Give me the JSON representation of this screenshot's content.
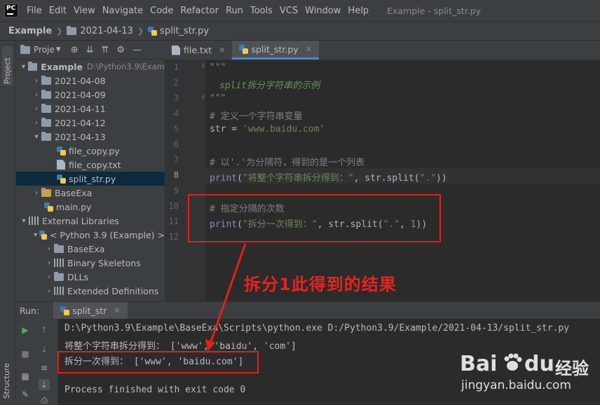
{
  "app": {
    "logo": "PC",
    "menu": [
      "File",
      "Edit",
      "View",
      "Navigate",
      "Code",
      "Refactor",
      "Run",
      "Tools",
      "VCS",
      "Window",
      "Help"
    ],
    "window_title": "Example - split_str.py"
  },
  "breadcrumb": [
    "Example",
    "2021-04-13",
    "split_str.py"
  ],
  "sidebar": {
    "tabs": {
      "project": "Project",
      "structure": "Structure"
    },
    "header_label": "Proje",
    "tree": [
      {
        "label": "Example",
        "path": "D:\\Python3.9\\Exam",
        "kind": "root"
      },
      {
        "label": "2021-04-08",
        "kind": "folder"
      },
      {
        "label": "2021-04-09",
        "kind": "folder"
      },
      {
        "label": "2021-04-11",
        "kind": "folder"
      },
      {
        "label": "2021-04-12",
        "kind": "folder"
      },
      {
        "label": "2021-04-13",
        "kind": "folder-open"
      },
      {
        "label": "file_copy.py",
        "kind": "py"
      },
      {
        "label": "file_copy.txt",
        "kind": "txt"
      },
      {
        "label": "split_str.py",
        "kind": "py"
      },
      {
        "label": "BaseExa",
        "kind": "folder-excluded"
      },
      {
        "label": "main.py",
        "kind": "py"
      },
      {
        "label": "External Libraries",
        "kind": "lib"
      },
      {
        "label": "< Python 3.9 (Example) >",
        "kind": "python"
      },
      {
        "label": "BaseExa",
        "kind": "folder"
      },
      {
        "label": "Binary Skeletons",
        "kind": "lib"
      },
      {
        "label": "DLLs",
        "kind": "folder"
      },
      {
        "label": "Extended Definitions",
        "kind": "lib"
      }
    ]
  },
  "editor": {
    "tabs": [
      "file.txt",
      "split_str.py"
    ],
    "line_numbers": [
      "1",
      "2",
      "3",
      "4",
      "5",
      "6",
      "7",
      "8",
      "9",
      "10",
      "11",
      "12"
    ],
    "code": {
      "l1": "\"\"\"",
      "l2": "split拆分字符串的示例",
      "l3": "\"\"\"",
      "l4": "# 定义一个字符串变量",
      "l5_a": "str = ",
      "l5_b": "'www.baidu.com'",
      "l7": "# 以'.'为分隔符，得到的是一个列表",
      "l8_kw": "print",
      "l8_a": "(",
      "l8_s1": "\"将整个字符串拆分得到：\"",
      "l8_b": ", str.split(",
      "l8_s2": "\".\"",
      "l8_c": "))",
      "l10": "# 指定分隔的次数",
      "l11_kw": "print",
      "l11_a": "(",
      "l11_s1": "\"拆分一次得到：\"",
      "l11_b": ", str.split(",
      "l11_s2": "\".\"",
      "l11_c": ", ",
      "l11_n": "1",
      "l11_d": "))"
    }
  },
  "annotation": {
    "text": "拆分1此得到的结果",
    "color": "#e0201c"
  },
  "run": {
    "label": "Run:",
    "tab": "split_str",
    "console": [
      "D:\\Python3.9\\Example\\BaseExa\\Scripts\\python.exe D:/Python3.9/Example/2021-04-13/split_str.py",
      "将整个字符串拆分得到： ['www', 'baidu', 'com']",
      "拆分一次得到： ['www', 'baidu.com']",
      "",
      "Process finished with exit code 0"
    ]
  },
  "watermark": {
    "brand": "Bai",
    "brand_suffix": "du",
    "cn": "经验",
    "url": "jingyan.baidu.com"
  },
  "colors": {
    "accent": "#4a88c7",
    "background": "#2b2b2b",
    "panel": "#3c3f41",
    "string": "#6a8759",
    "comment": "#808080"
  }
}
